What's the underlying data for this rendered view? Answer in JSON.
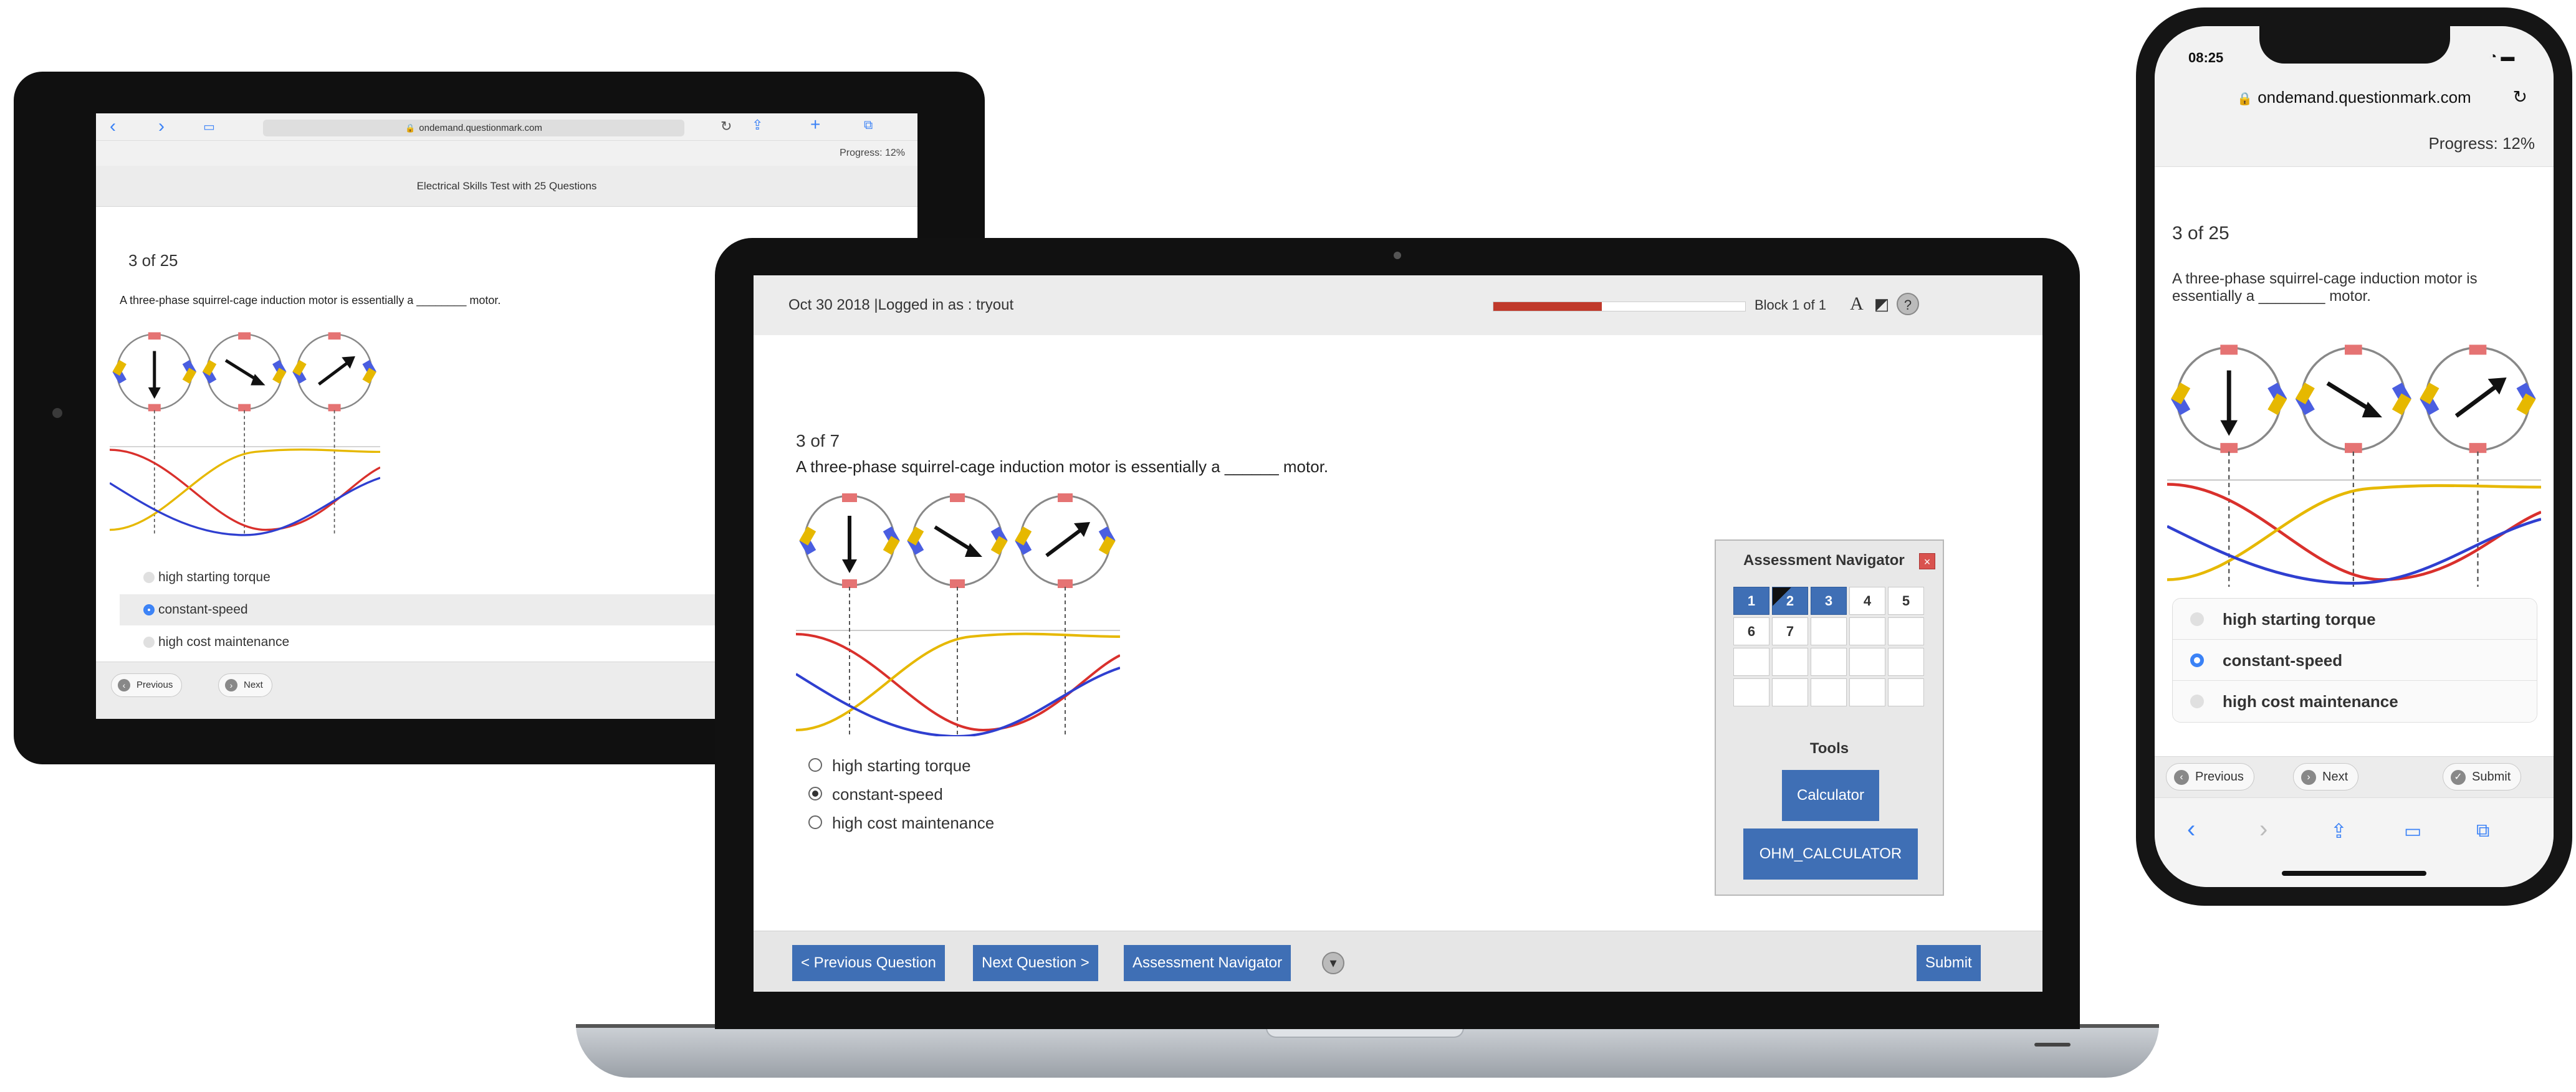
{
  "tablet": {
    "url": "ondemand.questionmark.com",
    "progress": "Progress: 12%",
    "test_title": "Electrical Skills Test with 25 Questions",
    "count": "3 of 25",
    "question": "A three-phase squirrel-cage induction motor is essentially a ________ motor.",
    "options": [
      "high starting torque",
      "constant-speed",
      "high cost maintenance"
    ],
    "selected_index": 1,
    "buttons": {
      "previous": "Previous",
      "next": "Next"
    }
  },
  "laptop": {
    "header_info": "Oct 30 2018 |Logged in as : tryout",
    "progress_fraction": 0.43,
    "block": "Block 1 of 1",
    "count": "3 of 7",
    "question": "A three-phase squirrel-cage induction motor is essentially a ______ motor.",
    "options": [
      "high starting torque",
      "constant-speed",
      "high cost maintenance"
    ],
    "selected_index": 1,
    "navigator": {
      "title": "Assessment Navigator",
      "close": "×",
      "cells": [
        "1",
        "2",
        "3",
        "4",
        "5",
        "6",
        "7",
        "",
        "",
        "",
        "",
        "",
        "",
        "",
        "",
        "",
        "",
        "",
        "",
        ""
      ],
      "answered": [
        0,
        1,
        2
      ],
      "flagged": [
        1
      ],
      "tools_label": "Tools",
      "tools": [
        "Calculator",
        "OHM_CALCULATOR"
      ]
    },
    "footer": {
      "prev": "< Previous Question",
      "next": "Next Question >",
      "navigator": "Assessment Navigator",
      "submit": "Submit"
    }
  },
  "phone": {
    "time": "08:25",
    "url": "ondemand.questionmark.com",
    "progress": "Progress: 12%",
    "count": "3 of 25",
    "question": "A three-phase squirrel-cage induction motor is essentially a ________ motor.",
    "options": [
      "high starting torque",
      "constant-speed",
      "high cost maintenance"
    ],
    "selected_index": 1,
    "buttons": {
      "previous": "Previous",
      "next": "Next",
      "submit": "Submit"
    }
  },
  "colors": {
    "accent_blue": "#3f6fb5",
    "ios_blue": "#3b82f6",
    "progress_red": "#c0392b",
    "curve_red": "#d9302c",
    "curve_yellow": "#e6b800",
    "curve_blue": "#2f3fd0"
  }
}
